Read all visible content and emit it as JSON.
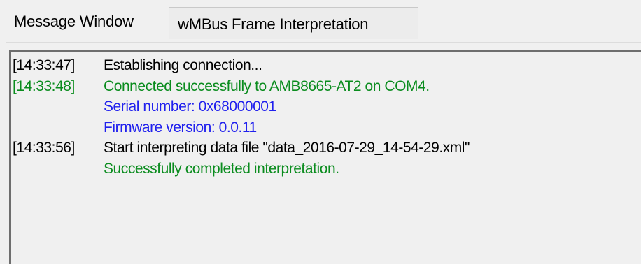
{
  "tabs": [
    {
      "label": "Message Window",
      "active": true
    },
    {
      "label": "wMBus Frame Interpretation",
      "active": false
    }
  ],
  "log": [
    {
      "timestamp": "[14:33:47]",
      "text": "Establishing connection...",
      "color": "#000000"
    },
    {
      "timestamp": "[14:33:48]",
      "text": "Connected successfully to AMB8665-AT2 on COM4.",
      "color": "#0a8c1e"
    },
    {
      "timestamp": "",
      "text": "Serial number: 0x68000001",
      "color": "#2020ee"
    },
    {
      "timestamp": "",
      "text": "Firmware version: 0.0.11",
      "color": "#2020ee"
    },
    {
      "timestamp": "[14:33:56]",
      "text": "Start interpreting data file \"data_2016-07-29_14-54-29.xml\"",
      "color": "#000000"
    },
    {
      "timestamp": "",
      "text": "Successfully completed interpretation.",
      "color": "#0a8c1e"
    }
  ]
}
